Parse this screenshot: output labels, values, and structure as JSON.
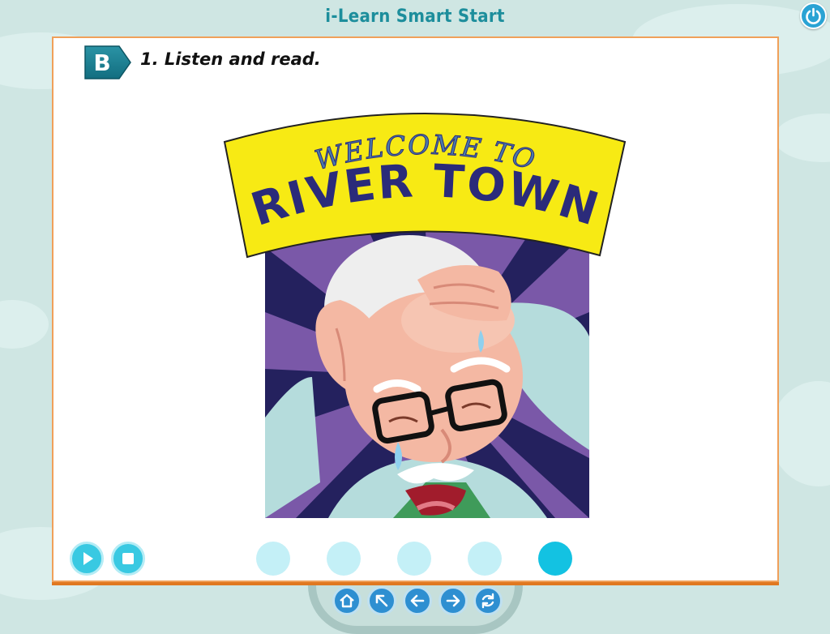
{
  "app": {
    "title": "i-Learn Smart Start"
  },
  "section": {
    "badge": "B",
    "instruction": "1. Listen and read."
  },
  "sign": {
    "line1": "WELCOME TO",
    "line2": "RIVER TOWN"
  },
  "audio": {
    "play_icon": "play-icon",
    "stop_icon": "stop-icon"
  },
  "pager": {
    "count": 5,
    "active_index": 5
  },
  "nav": {
    "icons": [
      "home-icon",
      "back-arrow-icon",
      "previous-icon",
      "next-icon",
      "refresh-icon"
    ]
  },
  "colors": {
    "accent": "#1d8e9c",
    "panel_border": "#f0a05a",
    "sign_yellow": "#f7ea14",
    "text_navy": "#2b2b7a"
  }
}
